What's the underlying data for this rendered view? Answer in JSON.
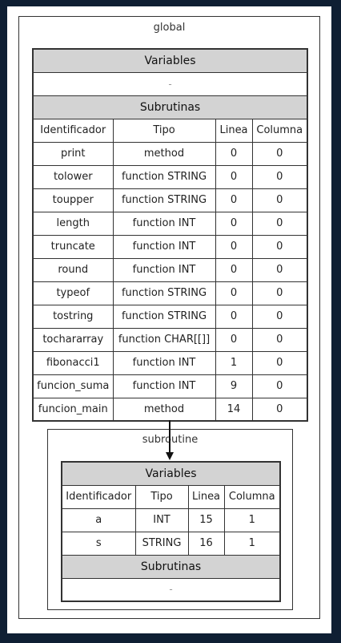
{
  "global": {
    "label": "global",
    "variables_header": "Variables",
    "variables_empty": "-",
    "subrutinas_header": "Subrutinas",
    "columns": [
      "Identificador",
      "Tipo",
      "Linea",
      "Columna"
    ],
    "rows": [
      [
        "print",
        "method",
        "0",
        "0"
      ],
      [
        "tolower",
        "function STRING",
        "0",
        "0"
      ],
      [
        "toupper",
        "function STRING",
        "0",
        "0"
      ],
      [
        "length",
        "function INT",
        "0",
        "0"
      ],
      [
        "truncate",
        "function INT",
        "0",
        "0"
      ],
      [
        "round",
        "function INT",
        "0",
        "0"
      ],
      [
        "typeof",
        "function STRING",
        "0",
        "0"
      ],
      [
        "tostring",
        "function STRING",
        "0",
        "0"
      ],
      [
        "tochararray",
        "function CHAR[[]]",
        "0",
        "0"
      ],
      [
        "fibonacci1",
        "function INT",
        "1",
        "0"
      ],
      [
        "funcion_suma",
        "function INT",
        "9",
        "0"
      ],
      [
        "funcion_main",
        "method",
        "14",
        "0"
      ]
    ]
  },
  "subroutine": {
    "label": "subroutine",
    "variables_header": "Variables",
    "columns": [
      "Identificador",
      "Tipo",
      "Linea",
      "Columna"
    ],
    "rows": [
      [
        "a",
        "INT",
        "15",
        "1"
      ],
      [
        "s",
        "STRING",
        "16",
        "1"
      ]
    ],
    "subrutinas_header": "Subrutinas",
    "subrutinas_empty": "-"
  }
}
